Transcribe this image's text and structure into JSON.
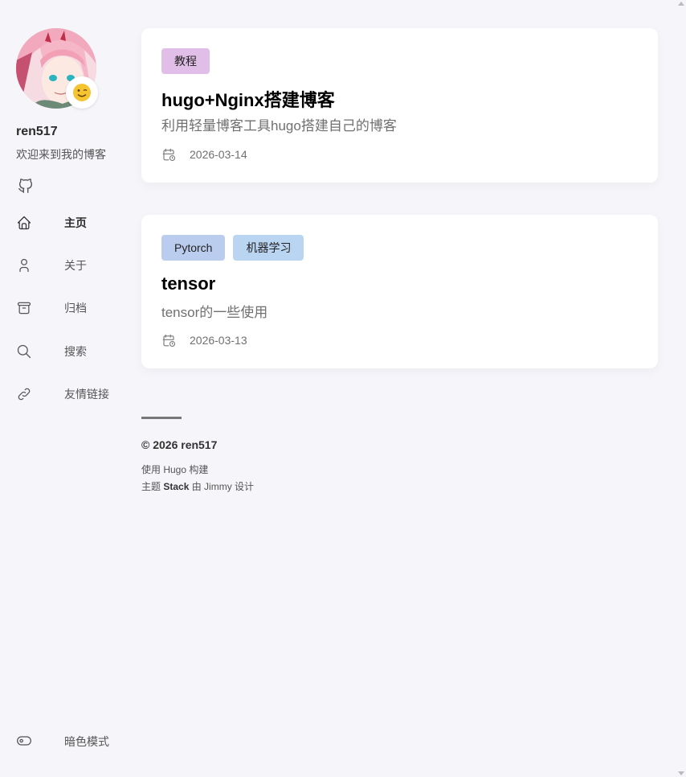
{
  "profile": {
    "name": "ren517",
    "description": "欢迎来到我的博客",
    "emoji": "😉"
  },
  "menu": {
    "items": [
      {
        "label": "主页",
        "icon": "home-icon",
        "active": true
      },
      {
        "label": "关于",
        "icon": "user-icon",
        "active": false
      },
      {
        "label": "归档",
        "icon": "archive-icon",
        "active": false
      },
      {
        "label": "搜索",
        "icon": "search-icon",
        "active": false
      },
      {
        "label": "友情链接",
        "icon": "link-icon",
        "active": false
      }
    ],
    "dark_mode_label": "暗色模式"
  },
  "posts": [
    {
      "tags": [
        {
          "label": "教程",
          "color": "#e1bee7"
        }
      ],
      "title": "hugo+Nginx搭建博客",
      "subtitle": "利用轻量博客工具hugo搭建自己的博客",
      "date": "2026-03-14"
    },
    {
      "tags": [
        {
          "label": "Pytorch",
          "color": "#bbcdee"
        },
        {
          "label": "机器学习",
          "color": "#bad5f2"
        }
      ],
      "title": "tensor",
      "subtitle": "tensor的一些使用",
      "date": "2026-03-13"
    }
  ],
  "footer": {
    "copyright": "© 2026 ren517",
    "powered_by": "使用 Hugo 构建",
    "theme_prefix": "主题 ",
    "theme_name": "Stack",
    "theme_suffix": " 由 Jimmy 设计"
  },
  "colors": {
    "background": "#f5f5fa",
    "card": "#ffffff",
    "accent_text": "#2c2c2c"
  }
}
